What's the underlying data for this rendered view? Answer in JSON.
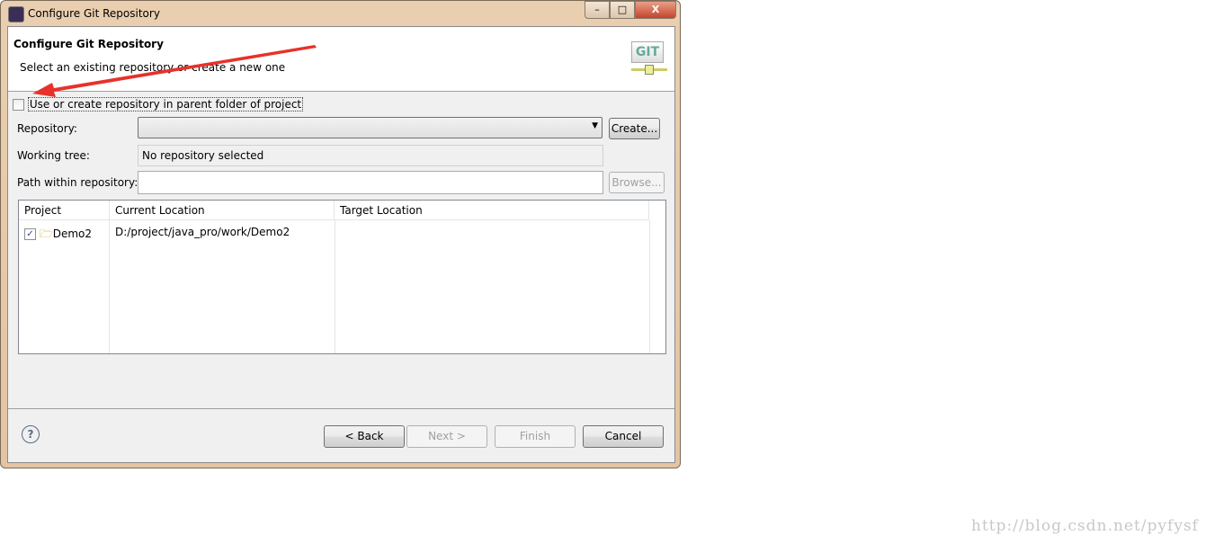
{
  "window": {
    "title": "Configure Git Repository",
    "minimize": "–",
    "maximize": "□",
    "close": "X"
  },
  "header": {
    "title": "Configure Git Repository",
    "description": "Select an existing repository or create a new one",
    "logo_text": "GIT"
  },
  "parent_folder_checkbox": {
    "label": "Use or create repository in parent folder of project",
    "checked": false
  },
  "repository": {
    "label": "Repository:",
    "value": "",
    "create_label": "Create..."
  },
  "working_tree": {
    "label": "Working tree:",
    "value": "No repository selected"
  },
  "path": {
    "label": "Path within repository:",
    "value": "",
    "browse_label": "Browse..."
  },
  "table": {
    "columns": [
      "Project",
      "Current Location",
      "Target Location"
    ],
    "rows": [
      {
        "checked": true,
        "project": "Demo2",
        "current": "D:/project/java_pro/work/Demo2",
        "target": ""
      }
    ]
  },
  "footer": {
    "back": "< Back",
    "next": "Next >",
    "finish": "Finish",
    "cancel": "Cancel",
    "help": "?"
  },
  "watermark": "http://blog.csdn.net/pyfysf",
  "colors": {
    "arrow": "#e8312a"
  }
}
